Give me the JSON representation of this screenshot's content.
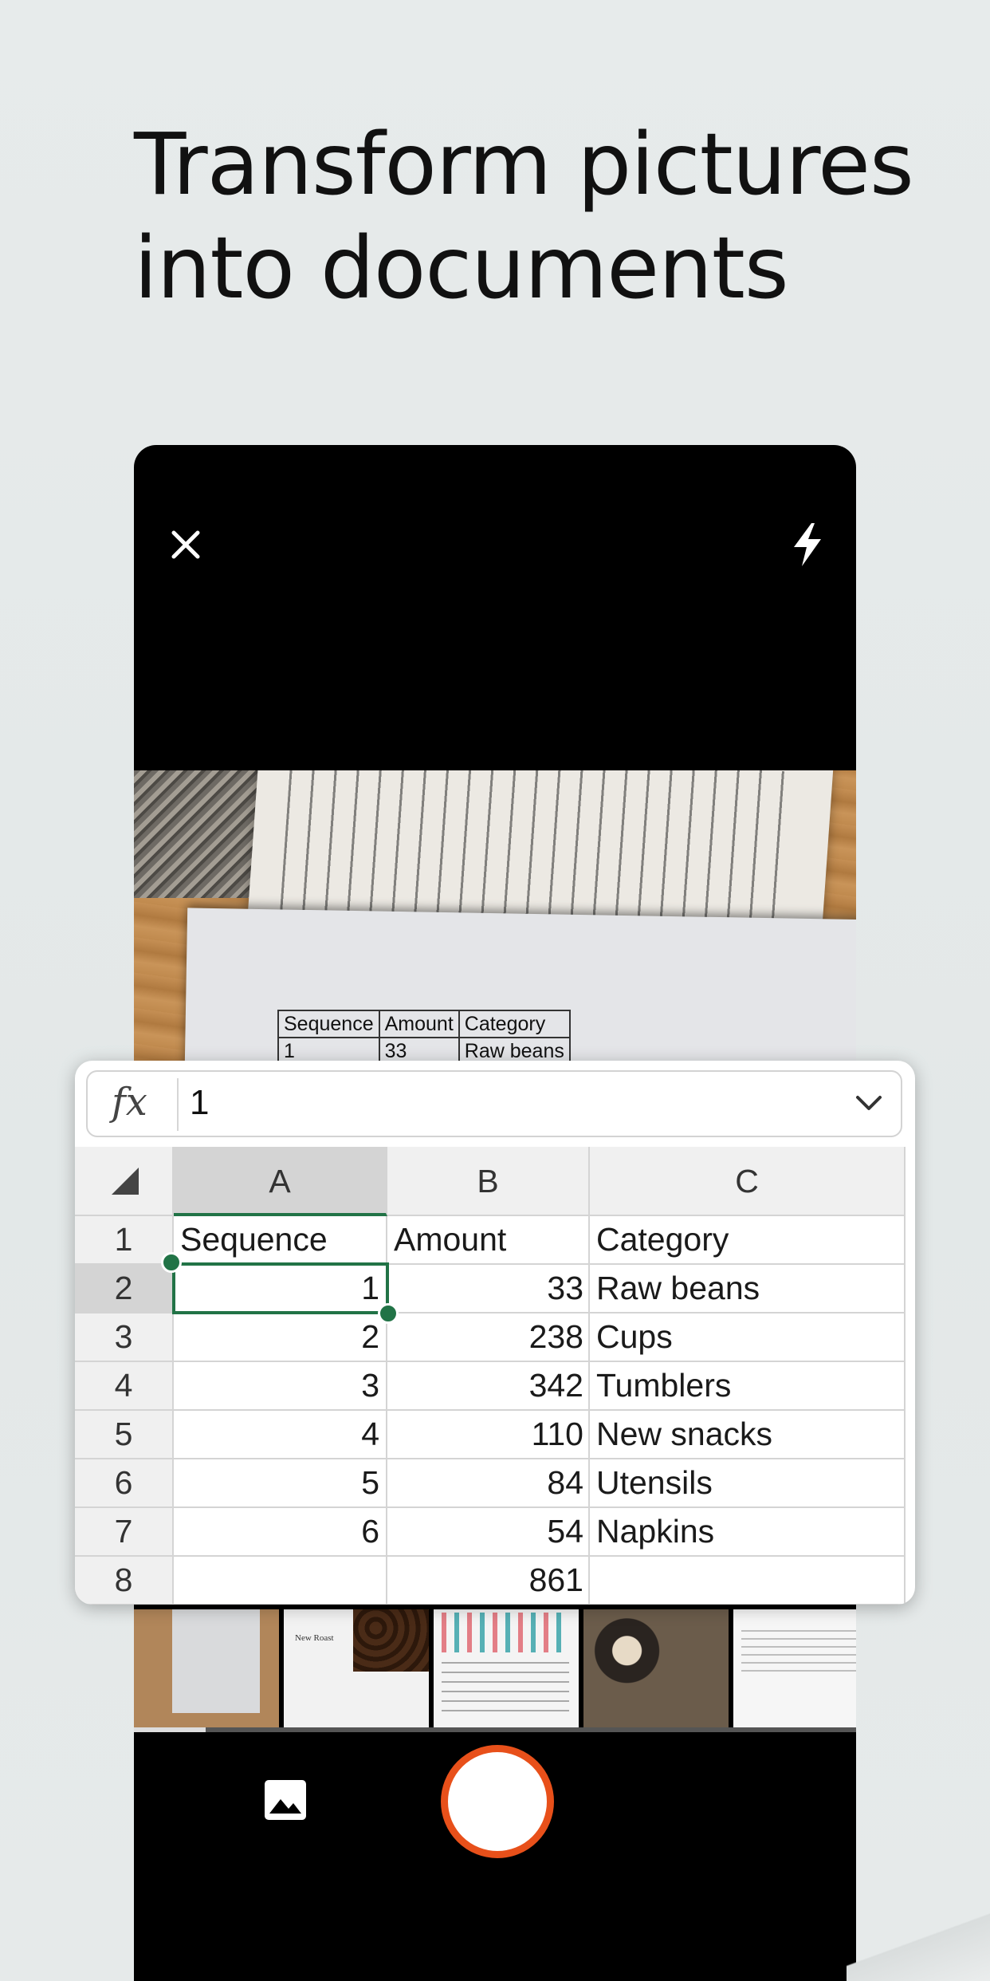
{
  "headline": {
    "line1": "Transform pictures",
    "line2": "into documents"
  },
  "camera": {
    "close_icon": "close-icon",
    "flash_icon": "flash-icon",
    "gallery_icon": "gallery-icon",
    "scanned_table": {
      "header": [
        "Sequence",
        "Amount",
        "Category"
      ],
      "row": [
        "1",
        "33",
        "Raw beans"
      ]
    },
    "thumbnail_labels": [
      "New Roast"
    ]
  },
  "spreadsheet": {
    "formula_label": "fx",
    "formula_value": "1",
    "columns": [
      "A",
      "B",
      "C"
    ],
    "rows": [
      {
        "num": "1",
        "a": "Sequence",
        "b": "Amount",
        "c": "Category"
      },
      {
        "num": "2",
        "a": "1",
        "b": "33",
        "c": "Raw beans"
      },
      {
        "num": "3",
        "a": "2",
        "b": "238",
        "c": "Cups"
      },
      {
        "num": "4",
        "a": "3",
        "b": "342",
        "c": "Tumblers"
      },
      {
        "num": "5",
        "a": "4",
        "b": "110",
        "c": "New snacks"
      },
      {
        "num": "6",
        "a": "5",
        "b": "84",
        "c": "Utensils"
      },
      {
        "num": "7",
        "a": "6",
        "b": "54",
        "c": "Napkins"
      },
      {
        "num": "8",
        "a": "",
        "b": "861",
        "c": ""
      }
    ],
    "selected_cell": "A2",
    "accent_color": "#217346"
  },
  "shutter_color": "#e8501a"
}
